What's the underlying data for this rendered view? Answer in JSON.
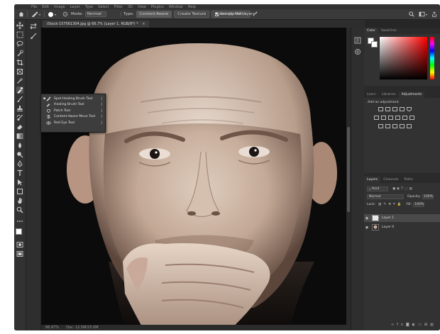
{
  "menubar": {
    "items": [
      "File",
      "Edit",
      "Image",
      "Layer",
      "Type",
      "Select",
      "Filter",
      "3D",
      "View",
      "Plugins",
      "Window",
      "Help"
    ]
  },
  "options": {
    "mode_label": "Mode:",
    "mode_value": "Normal",
    "type_label": "Type:",
    "content_aware": "Content-Aware",
    "create_texture": "Create Texture",
    "proximity_match": "Proximity Match",
    "sample_all_layers": "Sample All Layers"
  },
  "document": {
    "tab_title": "iStock-157561304.jpg @ 66.7% (Layer 1, RGB/8*) *"
  },
  "status": {
    "zoom": "66.67%",
    "doc": "Doc: 12.5M/25.0M"
  },
  "flyout": {
    "items": [
      {
        "label": "Spot Healing Brush Tool",
        "key": "J",
        "selected": true
      },
      {
        "label": "Healing Brush Tool",
        "key": "J",
        "selected": false
      },
      {
        "label": "Patch Tool",
        "key": "J",
        "selected": false
      },
      {
        "label": "Content-Aware Move Tool",
        "key": "J",
        "selected": false
      },
      {
        "label": "Red Eye Tool",
        "key": "J",
        "selected": false
      }
    ]
  },
  "color_panel": {
    "tabs": [
      "Color",
      "Swatches"
    ]
  },
  "adjust_panel": {
    "tabs": [
      "Learn",
      "Libraries",
      "Adjustments"
    ],
    "add_label": "Add an adjustment"
  },
  "layers_panel": {
    "tabs": [
      "Layers",
      "Channels",
      "Paths"
    ],
    "kind_label": "Kind",
    "blend_mode": "Normal",
    "opacity_label": "Opacity:",
    "opacity_value": "100%",
    "lock_label": "Lock:",
    "fill_label": "Fill:",
    "fill_value": "100%",
    "layers": [
      {
        "name": "Layer 1",
        "selected": true
      },
      {
        "name": "Layer 0",
        "selected": false
      }
    ]
  },
  "colors": {
    "accent": "#1473e6",
    "panel": "#323232",
    "canvas_bg": "#0c0c0c"
  }
}
